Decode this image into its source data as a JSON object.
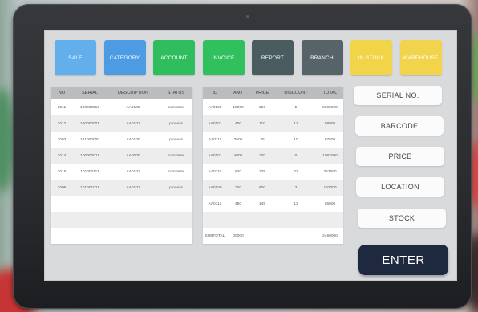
{
  "nav_buttons": [
    {
      "label": "SALE",
      "color": "#63afeb"
    },
    {
      "label": "CATEGORY",
      "color": "#4d9be2"
    },
    {
      "label": "ACCOUNT",
      "color": "#2fbd5d"
    },
    {
      "label": "INVOICE",
      "color": "#31c05e"
    },
    {
      "label": "REPORT",
      "color": "#4a5c60"
    },
    {
      "label": "BRANCH",
      "color": "#56646a"
    },
    {
      "label": "IN STOCK",
      "color": "#f1d447"
    },
    {
      "label": "WAREHOUSE",
      "color": "#f2d44c"
    }
  ],
  "serial_table": {
    "headers": [
      "NO",
      "SERIAL",
      "DESCRIPTION",
      "STATUS"
    ],
    "rows": [
      [
        "2011",
        "100000010",
        "AA0102",
        "complete"
      ],
      [
        "2012",
        "100000001",
        "AA0101",
        "process"
      ],
      [
        "2003",
        "101000000",
        "AA0100",
        "process"
      ],
      [
        "2014",
        "100000011",
        "AA0000",
        "complete"
      ],
      [
        "2015",
        "101000111",
        "AA0101",
        "complete"
      ],
      [
        "2006",
        "101001011",
        "AA0101",
        "process"
      ]
    ]
  },
  "sales_table": {
    "headers": [
      "ID",
      "AMT",
      "PRICE",
      "DISCOUNT",
      "TOTAL"
    ],
    "rows": [
      [
        "AA0120",
        "10000",
        "256",
        "5",
        "2560000"
      ],
      [
        "AA0101",
        "400",
        "110",
        "12",
        "88000"
      ],
      [
        "AA0111",
        "3500",
        "25",
        "10",
        "87500"
      ],
      [
        "AA0101",
        "4000",
        "270",
        "0",
        "1092000"
      ],
      [
        "AA0110",
        "820",
        "275",
        "22",
        "357500"
      ],
      [
        "AA0100",
        "320",
        "600",
        "3",
        "192000"
      ],
      [
        "AA0112",
        "450",
        "145",
        "13",
        "65000"
      ]
    ],
    "footer": {
      "label": "SUBTOTAL",
      "amount": "00000",
      "total": "2460000"
    }
  },
  "side_buttons": [
    "SERIAL NO.",
    "BARCODE",
    "PRICE",
    "LOCATION",
    "STOCK"
  ],
  "enter_label": "ENTER",
  "colors": {
    "screen": "#d9dadc",
    "enter": "#1e2940",
    "bezel": "#2c2e32"
  }
}
